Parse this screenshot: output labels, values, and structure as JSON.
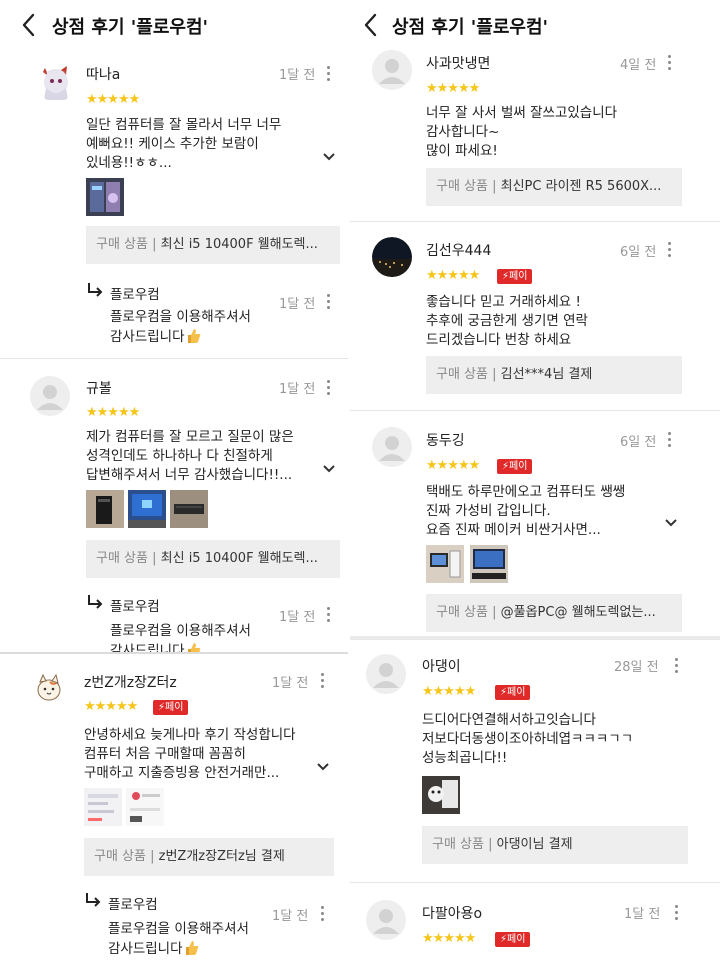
{
  "header": {
    "title": "상점 후기 '플로우컴'"
  },
  "left": {
    "reviews": [
      {
        "name": "따나a",
        "time": "1달 전",
        "stars": "★★★★★",
        "pay_badge": "",
        "text": "일단 컴퓨터를 잘 몰라서 너무 너무\n예뻐요!! 케이스 추가한 보람이\n있네용!!ㅎㅎ...",
        "product_label": "구매 상품",
        "product_name": "최신 i5 10400F 웰해도렉...",
        "reply": {
          "name": "플로우컴",
          "time": "1달 전",
          "text": "플로우컴을 이용해주셔서\n감사드립니다"
        }
      },
      {
        "name": "규볼",
        "time": "1달 전",
        "stars": "★★★★★",
        "pay_badge": "",
        "text": "제가 컴퓨터를 잘 모르고 질문이 많은\n성격인데도 하나하나 다 친절하게\n답변해주셔서 너무 감사했습니다!!...",
        "product_label": "구매 상품",
        "product_name": "최신 i5 10400F 웰해도렉...",
        "reply": {
          "name": "플로우컴",
          "time": "1달 전",
          "text": "플로우컴을 이용해주셔서\n감사드립니다"
        }
      },
      {
        "name": "z번Z개z장Z터z",
        "time": "1달 전",
        "stars": "★★★★★",
        "pay_badge": "⚡페이",
        "text": "안녕하세요 늦게나마 후기 작성합니다\n컴퓨터 처음 구매할때 꼼꼼히\n구매하고 지출증빙용 안전거래만...",
        "product_label": "구매 상품",
        "product_name": "z번Z개z장Z터z님 결제",
        "reply": {
          "name": "플로우컴",
          "time": "1달 전",
          "text": "플로우컴을 이용해주셔서\n감사드립니다"
        }
      }
    ]
  },
  "right": {
    "reviews": [
      {
        "name": "사과맛냉면",
        "time": "4일 전",
        "stars": "★★★★★",
        "pay_badge": "",
        "text": "너무 잘 사서 벌써 잘쓰고있습니다\n감사합니다~\n많이 파세요!",
        "product_label": "구매 상품",
        "product_name": "최신PC 라이젠 R5 5600X..."
      },
      {
        "name": "김선우444",
        "time": "6일 전",
        "stars": "★★★★★",
        "pay_badge": "⚡페이",
        "text": "좋습니다 믿고 거래하세요 !\n추후에 궁금한게 생기면 연락\n드리겠습니다 번창 하세요",
        "product_label": "구매 상품",
        "product_name": "김선***4님 결제"
      },
      {
        "name": "동두깅",
        "time": "6일 전",
        "stars": "★★★★★",
        "pay_badge": "⚡페이",
        "text": "택배도 하루만에오고 컴퓨터도 쌩쌩\n진짜 가성비 갑입니다.\n요즘 진짜 메이커 비싼거사면...",
        "product_label": "구매 상품",
        "product_name": "@풀옵PC@ 웰해도렉없는..."
      },
      {
        "name": "아댕이",
        "time": "28일 전",
        "stars": "★★★★★",
        "pay_badge": "⚡페이",
        "text": "드디어다연결해서하고잇습니다\n저보다더동생이조아하네엽ㅋㅋㅋㄱㄱ\n성능최곱니다!!",
        "product_label": "구매 상품",
        "product_name": "아댕이님 결제"
      },
      {
        "name": "다팔아용o",
        "time": "1달 전",
        "stars": "★★★★★",
        "pay_badge": "⚡페이"
      }
    ]
  },
  "colors": {
    "star": "#f5c518",
    "pay_badge": "#e02a2a",
    "product_box": "#eeeeee",
    "muted_text": "#999999"
  },
  "icons": {
    "back": "chevron-left-icon",
    "more": "more-vertical-icon",
    "expand": "chevron-down-icon",
    "reply": "reply-arrow-icon",
    "thumbs_up": "thumbs-up-icon"
  }
}
